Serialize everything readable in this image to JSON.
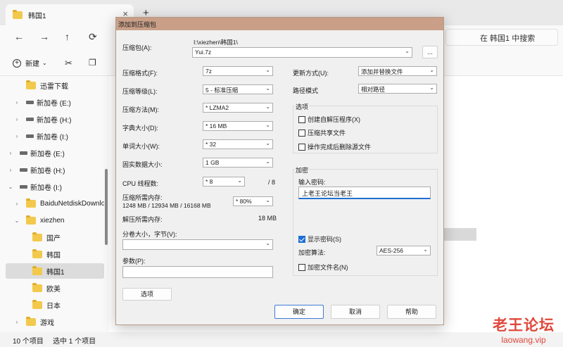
{
  "explorer": {
    "tab_title": "韩国1",
    "tab_close": "×",
    "tab_add": "+",
    "search_placeholder": "在 韩国1 中搜索",
    "new_label": "新建",
    "nav": [
      {
        "label": "迅雷下载",
        "kind": "folder",
        "indent": 1,
        "chevron": "",
        "selected": false
      },
      {
        "label": "新加卷 (E:)",
        "kind": "drive",
        "indent": 1,
        "chevron": "›",
        "selected": false
      },
      {
        "label": "新加卷 (H:)",
        "kind": "drive",
        "indent": 1,
        "chevron": "›",
        "selected": false
      },
      {
        "label": "新加卷 (I:)",
        "kind": "drive",
        "indent": 1,
        "chevron": "›",
        "selected": false
      },
      {
        "label": "新加卷 (E:)",
        "kind": "drive",
        "indent": 0,
        "chevron": "›",
        "selected": false
      },
      {
        "label": "新加卷 (H:)",
        "kind": "drive",
        "indent": 0,
        "chevron": "›",
        "selected": false
      },
      {
        "label": "新加卷 (I:)",
        "kind": "drive",
        "indent": 0,
        "chevron": "⌄",
        "selected": false
      },
      {
        "label": "BaiduNetdiskDownloa",
        "kind": "folder",
        "indent": 1,
        "chevron": "›",
        "selected": false
      },
      {
        "label": "xiezhen",
        "kind": "folder",
        "indent": 1,
        "chevron": "⌄",
        "selected": false
      },
      {
        "label": "国产",
        "kind": "folder",
        "indent": 2,
        "chevron": "",
        "selected": false
      },
      {
        "label": "韩国",
        "kind": "folder",
        "indent": 2,
        "chevron": "",
        "selected": false
      },
      {
        "label": "韩国1",
        "kind": "folder",
        "indent": 2,
        "chevron": "",
        "selected": true
      },
      {
        "label": "欧美",
        "kind": "folder",
        "indent": 2,
        "chevron": "",
        "selected": false
      },
      {
        "label": "日本",
        "kind": "folder",
        "indent": 2,
        "chevron": "",
        "selected": false
      },
      {
        "label": "游戏",
        "kind": "folder",
        "indent": 1,
        "chevron": "›",
        "selected": false
      }
    ],
    "status_count": "10 个项目",
    "status_selected": "选中 1 个项目"
  },
  "watermark": {
    "main": "老王论坛",
    "sub": "laowang.vip"
  },
  "dialog": {
    "title": "添加到压缩包",
    "archive_label": "压缩包(A):",
    "archive_path": "I:\\xiezhen\\韩国1\\",
    "archive_name": "Yui.7z",
    "browse_label": "...",
    "format_label": "压缩格式(F):",
    "format_value": "7z",
    "level_label": "压缩等级(L):",
    "level_value": "5 - 标准压缩",
    "method_label": "压缩方法(M):",
    "method_value": "* LZMA2",
    "dict_label": "字典大小(D):",
    "dict_value": "* 16 MB",
    "word_label": "单词大小(W):",
    "word_value": "* 32",
    "solid_label": "固实数据大小:",
    "solid_value": "1 GB",
    "threads_label": "CPU 线程数:",
    "threads_value": "* 8",
    "threads_max": "/ 8",
    "mem_label": "压缩所需内存:",
    "mem_detail": "1248 MB / 12934 MB / 16168 MB",
    "mem_value": "* 80%",
    "decomp_label": "解压所需内存:",
    "decomp_value": "18 MB",
    "split_label": "分卷大小，字节(V):",
    "params_label": "参数(P):",
    "options_button": "选项",
    "update_label": "更新方式(U):",
    "update_value": "添加并替换文件",
    "pathmode_label": "路径模式",
    "pathmode_value": "相对路径",
    "options_group": "选项",
    "opt_sfx": "创建自解压程序(X)",
    "opt_shared": "压缩共享文件",
    "opt_delete": "操作完成后删除源文件",
    "encrypt_group": "加密",
    "password_label": "输入密码:",
    "password_value": "上老王论坛当老王",
    "show_password": "显示密码(S)",
    "enc_method_label": "加密算法:",
    "enc_method_value": "AES-256",
    "encrypt_names": "加密文件名(N)",
    "ok": "确定",
    "cancel": "取消",
    "help": "帮助"
  }
}
